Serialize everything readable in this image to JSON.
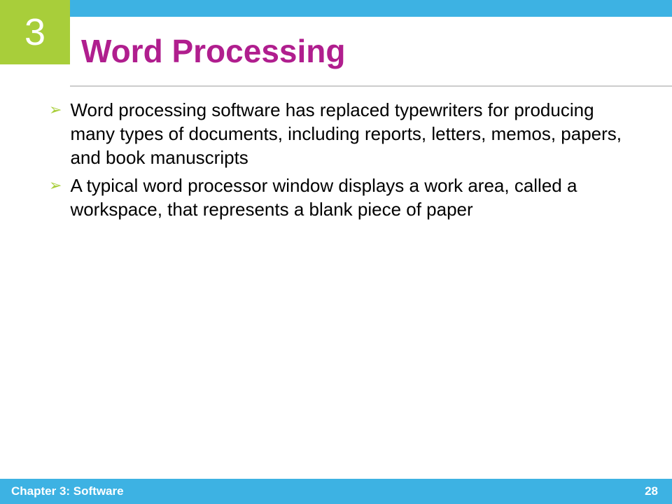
{
  "chapter": {
    "number": "3",
    "footer_label": "Chapter 3: Software"
  },
  "slide": {
    "title": "Word Processing",
    "page_number": "28"
  },
  "bullets": [
    "Word processing software has replaced typewriters for producing many types of documents, including reports, letters, memos, papers, and book manuscripts",
    "A typical word processor window displays a work area, called a workspace, that represents a blank piece of paper"
  ],
  "colors": {
    "accent_blue": "#3db2e3",
    "accent_green": "#a8ce3a",
    "title_magenta": "#b01e8e"
  }
}
